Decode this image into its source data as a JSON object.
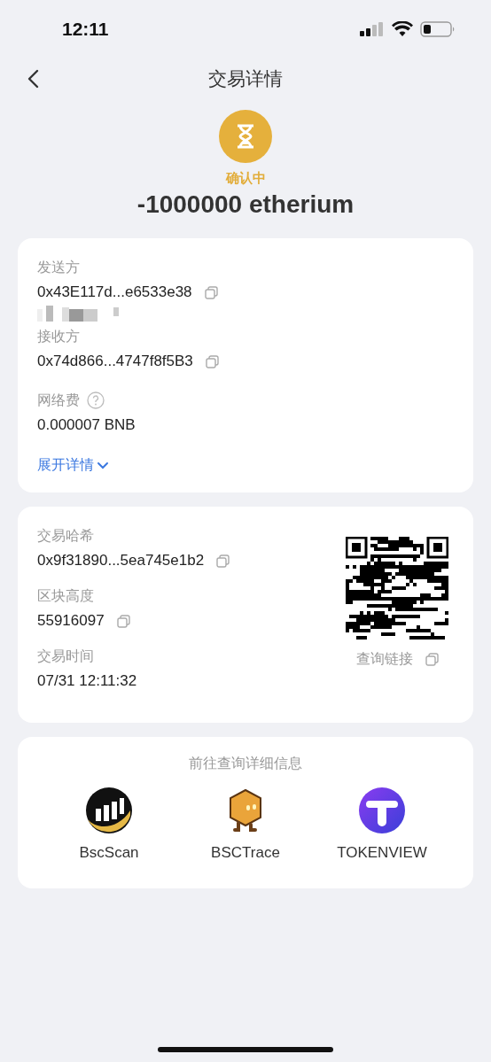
{
  "status_bar": {
    "time": "12:11"
  },
  "nav": {
    "title": "交易详情"
  },
  "summary": {
    "status": "确认中",
    "amount": "-1000000 etherium"
  },
  "parties": {
    "fields": [
      {
        "label": "发送方",
        "value": "0x43E117d...e6533e38",
        "copy": true,
        "help": false,
        "redacted": true
      },
      {
        "label": "接收方",
        "value": "0x74d866...4747f8f5B3",
        "copy": true,
        "help": false,
        "redacted": false
      },
      {
        "label": "网络费",
        "value": "0.000007 BNB",
        "copy": false,
        "help": true,
        "redacted": false
      }
    ],
    "expand_link": "展开详情"
  },
  "tx": {
    "fields": [
      {
        "label": "交易哈希",
        "value": "0x9f31890...5ea745e1b2",
        "copy": true
      },
      {
        "label": "区块高度",
        "value": "55916097",
        "copy": true
      },
      {
        "label": "交易时间",
        "value": "07/31 12:11:32",
        "copy": false
      }
    ],
    "qr_caption": "查询链接"
  },
  "explorers": {
    "title": "前往查询详细信息",
    "items": [
      {
        "kind": "bscscan",
        "name": "BscScan"
      },
      {
        "kind": "bsctrace",
        "name": "BSCTrace"
      },
      {
        "kind": "tokenview",
        "name": "TOKENVIEW"
      }
    ]
  }
}
